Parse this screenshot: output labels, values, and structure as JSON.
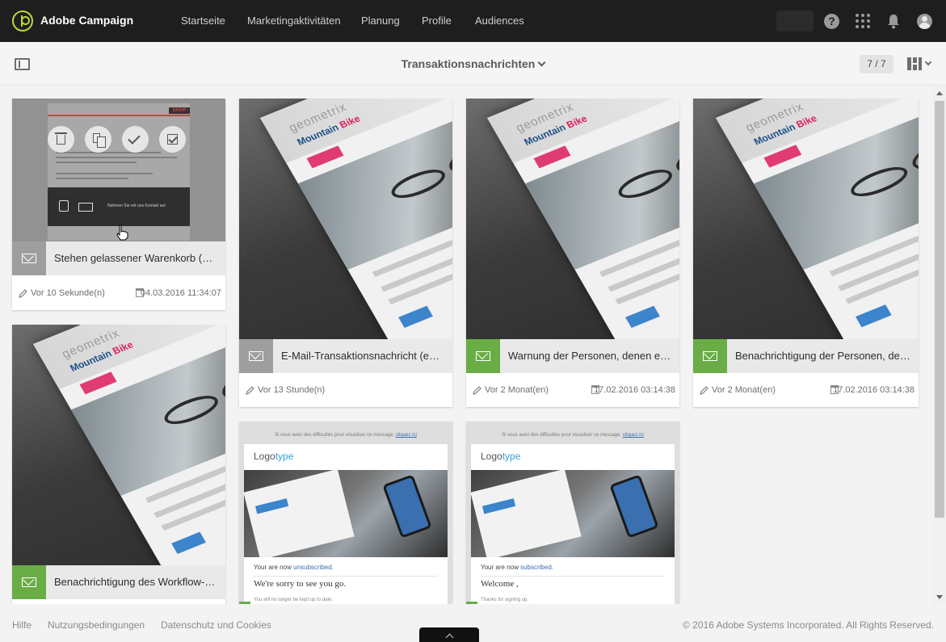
{
  "app": {
    "title": "Adobe Campaign",
    "nav": [
      "Startseite",
      "Marketingaktivitäten",
      "Planung",
      "Profile",
      "Audiences"
    ],
    "help_label": "?"
  },
  "subheader": {
    "title": "Transaktionsnachrichten",
    "count": "7 / 7"
  },
  "cards": [
    {
      "title": "Stehen gelassener Warenkorb (RT...",
      "modified": "Vor 10 Sekunde(n)",
      "date": "04.03.2016 11:34:07",
      "status_color": "#9e9e9e",
      "preview": {
        "logo": "SHOP",
        "contact_text": "Nehmen Sie mit uns Kontakt auf"
      }
    },
    {
      "title": "E-Mail-Transaktionsnachricht (em...",
      "modified": "Vor 13 Stunde(n)",
      "date": "",
      "status_color": "#9e9e9e",
      "preview": {
        "logo": "geometrix",
        "headline": "Mountain",
        "headline_accent": "Bike"
      }
    },
    {
      "title": "Warnung der Personen, denen ein...",
      "modified": "Vor 2 Monat(en)",
      "date": "17.02.2016 03:14:38",
      "status_color": "#6aad46",
      "preview": {
        "logo": "geometrix",
        "headline": "Mountain",
        "headline_accent": "Bike"
      }
    },
    {
      "title": "Benachrichtigung der Personen, den...",
      "modified": "Vor 2 Monat(en)",
      "date": "17.02.2016 03:14:38",
      "status_color": "#6aad46",
      "preview": {
        "logo": "geometrix",
        "headline": "Mountain",
        "headline_accent": "Bike"
      }
    },
    {
      "title": "Benachrichtigung des Workflow-V...",
      "status_color": "#6aad46",
      "preview": {
        "logo": "geometrix",
        "headline": "Mountain",
        "headline_accent": "Bike"
      }
    },
    {
      "status_color": "#6aad46",
      "preview": {
        "top_notice": "Si vous avez des difficultés pour visualiser ce message,",
        "top_link": "cliquez ici",
        "logo_a": "Logo",
        "logo_b": "type",
        "status_prefix": "Your are now",
        "status_word": "unsubscribed.",
        "message": "We're sorry to see you go.",
        "small": "You will no longer be kept up to date."
      }
    },
    {
      "status_color": "#6aad46",
      "preview": {
        "top_notice": "Si vous avez des difficultés pour visualiser ce message,",
        "top_link": "cliquez ici",
        "logo_a": "Logo",
        "logo_b": "type",
        "status_prefix": "Your are now",
        "status_word": "subscribed.",
        "message": "Welcome ,",
        "small": "Thanks for signing up."
      }
    }
  ],
  "footer": {
    "links": [
      "Hilfe",
      "Nutzungsbedingungen",
      "Datenschutz und Cookies"
    ],
    "copyright": "© 2016 Adobe Systems Incorporated. All Rights Reserved."
  }
}
